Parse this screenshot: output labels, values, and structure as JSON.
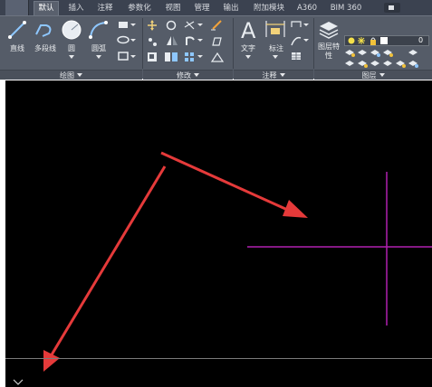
{
  "tabs": [
    "默认",
    "插入",
    "注释",
    "参数化",
    "视图",
    "管理",
    "输出",
    "附加模块",
    "A360",
    "BIM 360"
  ],
  "active_tab": "默认",
  "draw_panel": {
    "title": "绘图",
    "line": "直线",
    "polyline": "多段线",
    "circle": "圆",
    "arc": "圆弧"
  },
  "modify_panel": {
    "title": "修改"
  },
  "annotation_panel": {
    "title": "注释",
    "text": "文字",
    "dimension": "标注"
  },
  "layers_panel": {
    "title": "图层",
    "layer_properties": "图层特性",
    "current_layer": "0"
  },
  "colors": {
    "ribbon_bg": "#555c68",
    "tab_bar_bg": "#3b4250",
    "canvas_bg": "#000000",
    "crosshair": "#b020b0",
    "arrow": "#e53a3a"
  }
}
